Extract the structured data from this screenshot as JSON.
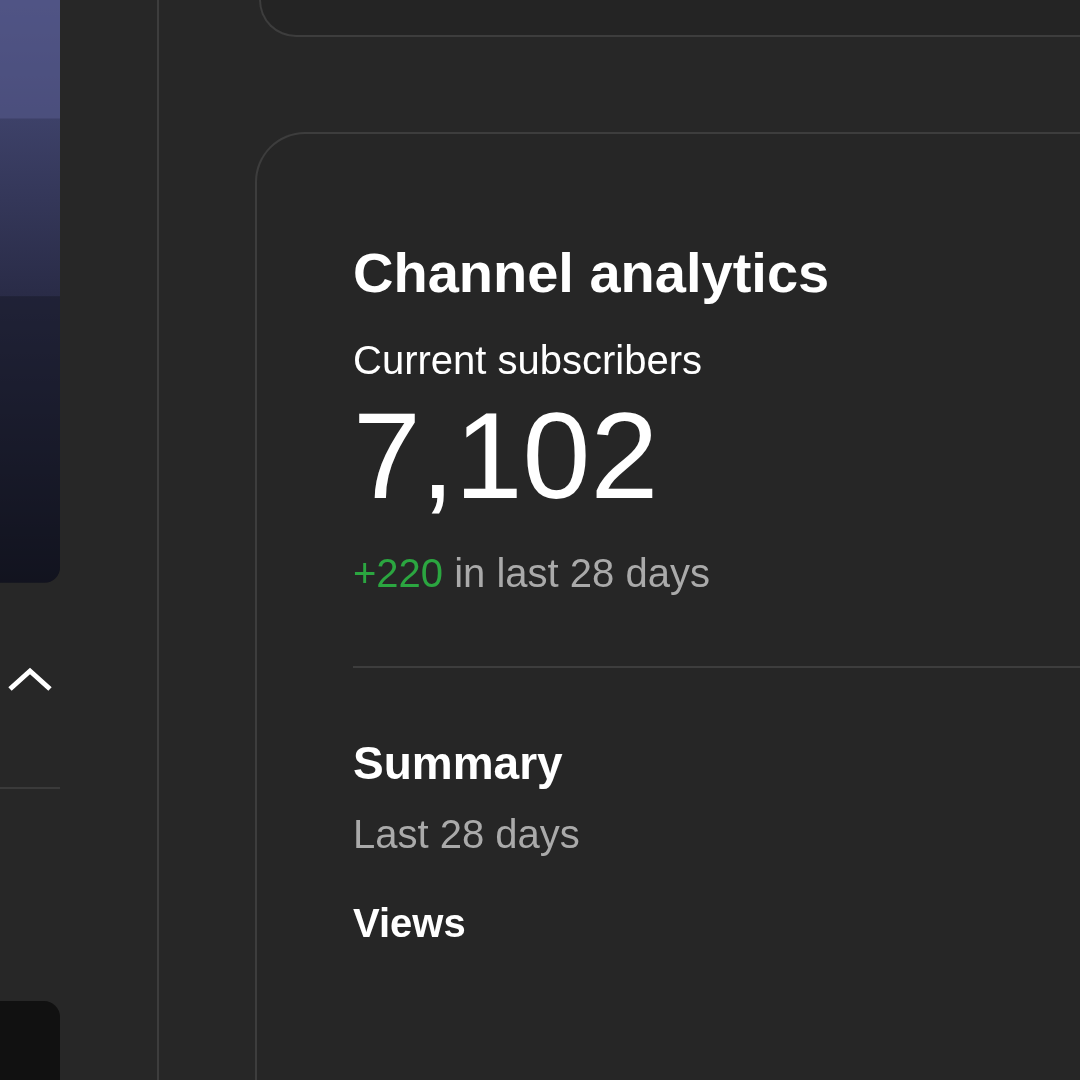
{
  "analytics_card": {
    "title": "Channel analytics",
    "subscribers_label": "Current subscribers",
    "subscribers_count": "7,102",
    "change": "+220",
    "change_period": "in last 28 days"
  },
  "summary": {
    "title": "Summary",
    "period": "Last 28 days",
    "first_metric": "Views"
  }
}
